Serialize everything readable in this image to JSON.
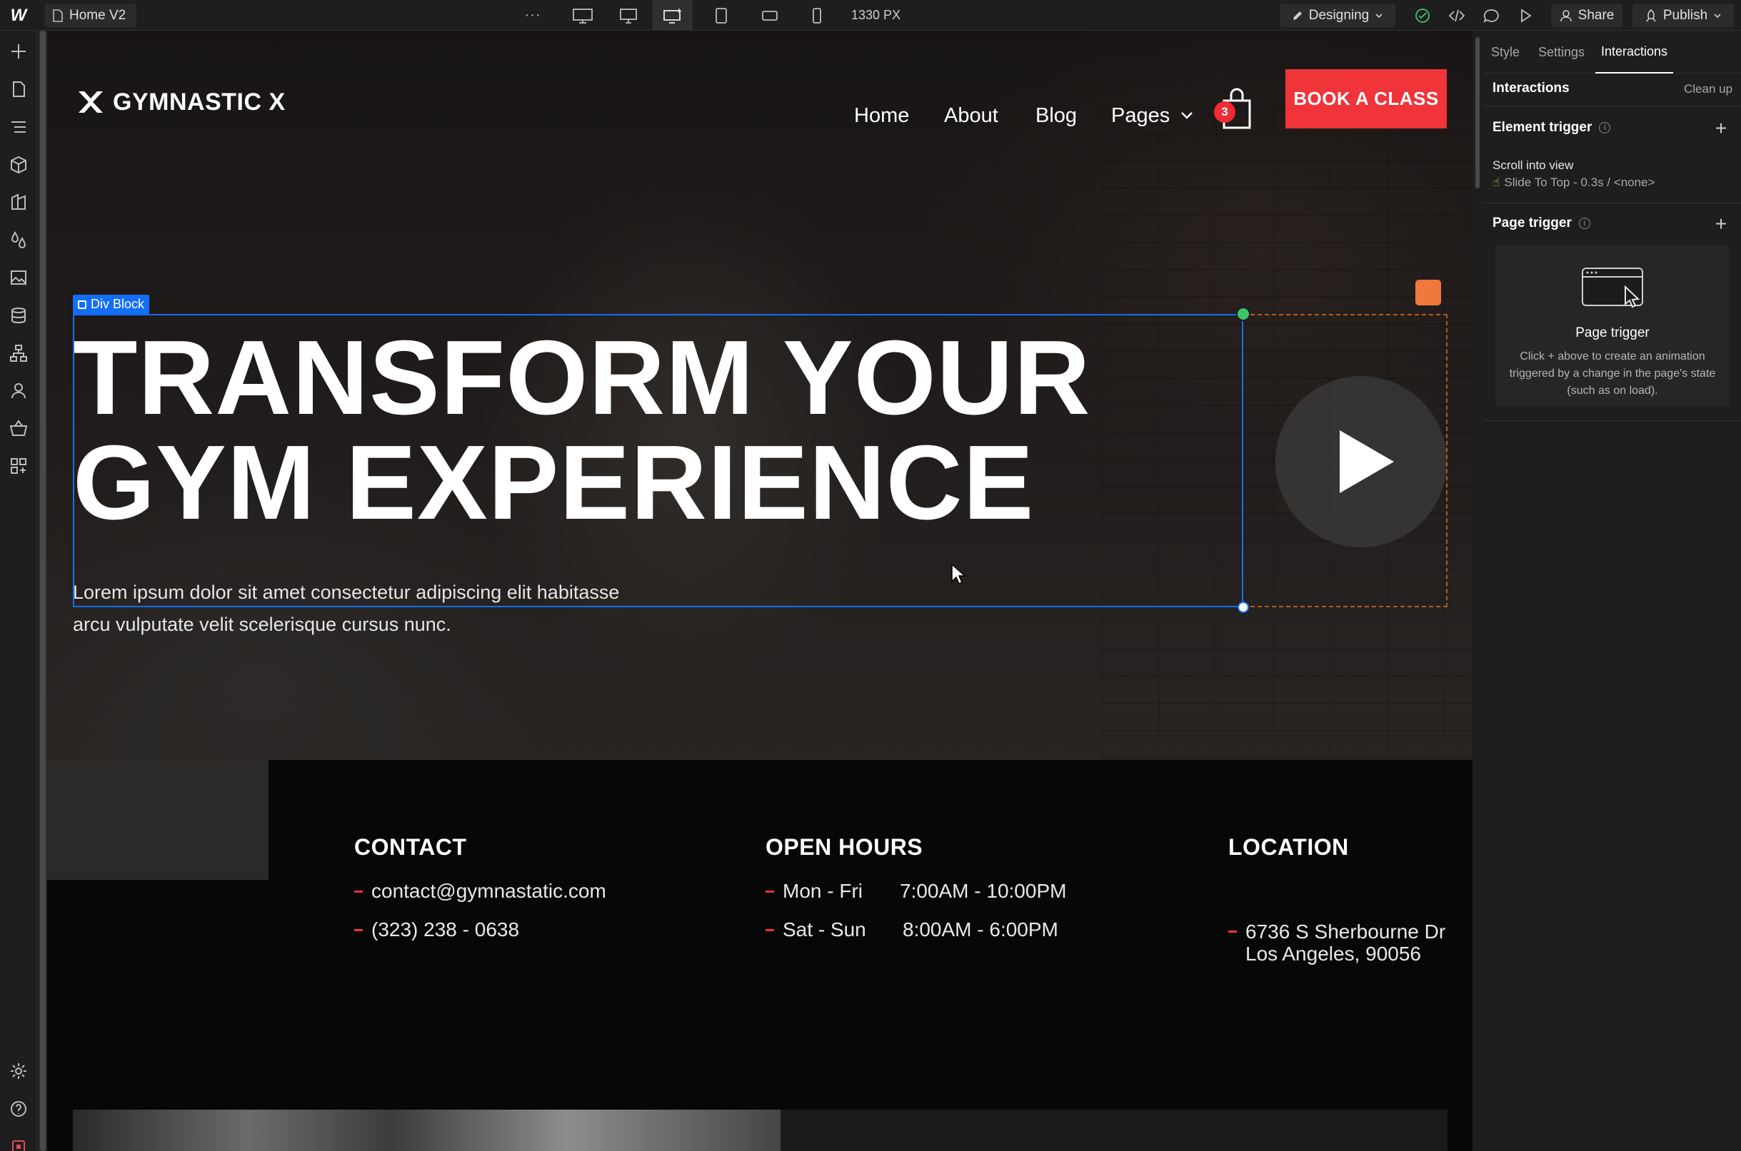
{
  "topbar": {
    "page_name": "Home V2",
    "width_readout": "1330 PX",
    "mode_label": "Designing",
    "share_label": "Share",
    "publish_label": "Publish"
  },
  "site": {
    "brand": "GYMNASTIC X",
    "nav": {
      "home": "Home",
      "about": "About",
      "blog": "Blog",
      "pages": "Pages"
    },
    "cart_count": "3",
    "cta": "BOOK A CLASS",
    "selection_label": "Div Block",
    "hero_line1": "TRANSFORM YOUR",
    "hero_line2": "GYM EXPERIENCE",
    "hero_sub_line1": "Lorem ipsum dolor sit amet consectetur adipiscing elit habitasse",
    "hero_sub_line2": "arcu vulputate velit scelerisque cursus nunc.",
    "contact": {
      "heading": "CONTACT",
      "email": "contact@gymnastatic.com",
      "phone": "(323) 238 - 0638"
    },
    "hours": {
      "heading": "OPEN HOURS",
      "rows": [
        {
          "days": "Mon - Fri",
          "time": "7:00AM - 10:00PM"
        },
        {
          "days": "Sat - Sun",
          "time": "8:00AM - 6:00PM"
        }
      ]
    },
    "location": {
      "heading": "LOCATION",
      "line1": "6736 S Sherbourne Dr",
      "line2": "Los Angeles, 90056"
    }
  },
  "panel": {
    "tabs": [
      "Style",
      "Settings",
      "Interactions"
    ],
    "active_tab": "Interactions",
    "title": "Interactions",
    "clean_up": "Clean up",
    "element_trigger": {
      "title": "Element trigger",
      "item_title": "Scroll into view",
      "item_detail": "Slide To Top - 0.3s / <none>"
    },
    "page_trigger": {
      "title": "Page trigger",
      "card_title": "Page trigger",
      "card_desc": "Click + above to create an animation triggered by a change in the page's state (such as on load)."
    }
  },
  "colors": {
    "accent_red": "#f1333a",
    "selection_blue": "#146ef5",
    "handle_green": "#3ec46d"
  }
}
